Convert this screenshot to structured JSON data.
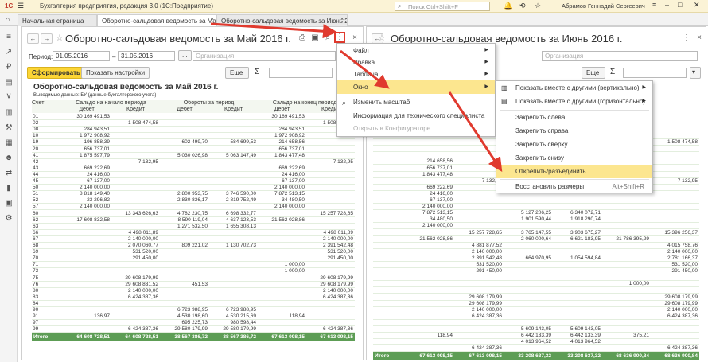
{
  "app": {
    "title": "Бухгалтерия предприятия, редакция 3.0  (1С:Предприятие)",
    "search_placeholder": "Поиск Ctrl+Shift+F",
    "user": "Абрамов Геннадий Сергеевич",
    "logo": "1С"
  },
  "tabs": [
    {
      "label": "Начальная страница"
    },
    {
      "label": "Оборотно-сальдовая ведомость за Май 2016 г."
    },
    {
      "label": "Оборотно-сальдовая ведомость за Июнь 2016 г."
    }
  ],
  "left_pane": {
    "title": "Оборотно-сальдовая ведомость за Май 2016 г.",
    "period_label": "Период:",
    "date_from": "01.05.2016",
    "date_to": "31.05.2016",
    "dots": "...",
    "org_placeholder": "Организация",
    "generate_button": "Сформировать",
    "settings_button": "Показать настройки",
    "more_button": "Еще",
    "sum_symbol": "Σ",
    "report_title": "Оборотно-сальдовая ведомость за Май 2016 г.",
    "report_subtitle": "Выводимые данные: БУ (данные бухгалтерского учета)",
    "h_account": "Счет",
    "h_start": "Сальдо на начало периода",
    "h_turn": "Обороты за период",
    "h_end": "Сальдо на конец периода",
    "h_debit": "Дебет",
    "h_credit": "Кредит",
    "rows": [
      [
        "01",
        "30 169 491,53",
        "",
        "",
        "",
        "30 169 491,53",
        ""
      ],
      [
        "02",
        "",
        "1 508 474,58",
        "",
        "",
        "",
        "1 508 474,58"
      ],
      [
        "08",
        "284 943,51",
        "",
        "",
        "",
        "284 943,51",
        ""
      ],
      [
        "10",
        "1 972 908,92",
        "",
        "",
        "",
        "1 972 908,92",
        ""
      ],
      [
        "19",
        "196 858,39",
        "",
        "602 499,70",
        "584 699,53",
        "214 658,56",
        ""
      ],
      [
        "20",
        "656 737,01",
        "",
        "",
        "",
        "656 737,01",
        ""
      ],
      [
        "41",
        "1 875 597,79",
        "",
        "5 030 026,98",
        "5 063 147,49",
        "1 843 477,48",
        ""
      ],
      [
        "42",
        "",
        "7 132,95",
        "",
        "",
        "",
        "7 132,95"
      ],
      [
        "43",
        "669 222,69",
        "",
        "",
        "",
        "669 222,69",
        ""
      ],
      [
        "44",
        "24 416,00",
        "",
        "",
        "",
        "24 416,00",
        ""
      ],
      [
        "45",
        "67 137,00",
        "",
        "",
        "",
        "67 137,00",
        ""
      ],
      [
        "50",
        "2 140 000,00",
        "",
        "",
        "",
        "2 140 000,00",
        ""
      ],
      [
        "51",
        "8 818 149,40",
        "",
        "2 800 953,75",
        "3 746 590,00",
        "7 872 513,15",
        ""
      ],
      [
        "52",
        "23 296,82",
        "",
        "2 830 836,17",
        "2 819 752,49",
        "34 480,50",
        ""
      ],
      [
        "57",
        "2 140 000,00",
        "",
        "",
        "",
        "2 140 000,00",
        ""
      ],
      [
        "60",
        "",
        "13 343 626,63",
        "4 782 230,75",
        "6 698 332,77",
        "",
        "15 257 728,65"
      ],
      [
        "62",
        "17 608 832,58",
        "",
        "8 590 119,04",
        "4 637 123,53",
        "21 562 028,86",
        ""
      ],
      [
        "63",
        "",
        "",
        "1 271 532,50",
        "1 655 308,13",
        "",
        ""
      ],
      [
        "66",
        "",
        "4 498 011,89",
        "",
        "",
        "",
        "4 498 011,89"
      ],
      [
        "67",
        "",
        "2 140 000,00",
        "",
        "",
        "",
        "2 140 000,00"
      ],
      [
        "68",
        "",
        "2 070 060,77",
        "809 221,02",
        "1 130 702,73",
        "",
        "2 391 542,48"
      ],
      [
        "69",
        "",
        "531 520,00",
        "",
        "",
        "",
        "531 520,00"
      ],
      [
        "70",
        "",
        "291 450,00",
        "",
        "",
        "",
        "291 450,00"
      ],
      [
        "71",
        "",
        "",
        "",
        "",
        "1 000,00",
        ""
      ],
      [
        "73",
        "",
        "",
        "",
        "",
        "1 000,00",
        ""
      ],
      [
        "75",
        "",
        "29 608 179,99",
        "",
        "",
        "",
        "29 608 179,99"
      ],
      [
        "76",
        "",
        "29 608 831,52",
        "451,53",
        "",
        "",
        "29 608 179,99"
      ],
      [
        "80",
        "",
        "2 140 000,00",
        "",
        "",
        "",
        "2 140 000,00"
      ],
      [
        "83",
        "",
        "6 424 387,36",
        "",
        "",
        "",
        "6 424 387,36"
      ],
      [
        "84",
        "",
        "",
        "",
        "",
        "",
        ""
      ],
      [
        "90",
        "",
        "",
        "6 723 988,95",
        "6 723 988,95",
        "",
        ""
      ],
      [
        "91",
        "136,97",
        "",
        "4 530 198,60",
        "4 530 215,69",
        "118,94",
        ""
      ],
      [
        "97",
        "",
        "",
        "695 225,73",
        "980 598,44",
        "",
        ""
      ],
      [
        "99",
        "",
        "6 424 387,36",
        "29 580 179,99",
        "29 580 179,99",
        "",
        "6 424 387,36"
      ]
    ],
    "total_label": "Итого",
    "total": [
      "64 608 728,51",
      "64 608 728,51",
      "38 567 386,72",
      "38 567 386,72",
      "67 613 098,15",
      "67 613 098,15"
    ]
  },
  "right_pane": {
    "title": "Оборотно-сальдовая ведомость за Июнь 2016 г.",
    "org_placeholder": "Организация",
    "more_button": "Еще",
    "total_label": "Итого",
    "rows": [
      [
        "",
        "",
        "",
        "",
        "30 169 491,53",
        ""
      ],
      [
        "",
        "",
        "",
        "",
        "",
        "1 508 474,58"
      ],
      [
        "",
        "",
        "",
        "",
        "284 943,51",
        ""
      ],
      [
        "",
        "",
        "",
        "",
        "1 972 908,92",
        ""
      ],
      [
        "214 658,56",
        "",
        "",
        "",
        "",
        ""
      ],
      [
        "656 737,01",
        "",
        "",
        "",
        "",
        ""
      ],
      [
        "1 843 477,48",
        "",
        "",
        "",
        "",
        ""
      ],
      [
        "",
        "7 132,95",
        "",
        "",
        "",
        "7 132,95"
      ],
      [
        "669 222,69",
        "",
        "",
        "",
        "",
        ""
      ],
      [
        "24 416,00",
        "",
        "",
        "",
        "",
        ""
      ],
      [
        "67 137,00",
        "",
        "",
        "",
        "",
        ""
      ],
      [
        "2 140 000,00",
        "",
        "",
        "",
        "",
        ""
      ],
      [
        "7 872 513,15",
        "",
        "5 127 206,25",
        "6 340 072,71",
        "",
        ""
      ],
      [
        "34 480,50",
        "",
        "1 901 590,44",
        "1 918 290,74",
        "",
        ""
      ],
      [
        "2 140 000,00",
        "",
        "",
        "",
        "",
        ""
      ],
      [
        "",
        "15 257 728,65",
        "3 765 147,55",
        "3 903 675,27",
        "",
        "15 396 256,37"
      ],
      [
        "21 562 028,86",
        "",
        "2 060 000,64",
        "6 621 183,95",
        "21 786 395,29",
        ""
      ],
      [
        "",
        "4 881 877,52",
        "",
        "",
        "",
        "4 015 758,76"
      ],
      [
        "",
        "2 140 000,00",
        "",
        "",
        "",
        "2 140 000,00"
      ],
      [
        "",
        "2 391 542,48",
        "664 970,95",
        "1 054 594,84",
        "",
        "2 781 166,37"
      ],
      [
        "",
        "531 520,00",
        "",
        "",
        "",
        "531 520,00"
      ],
      [
        "",
        "291 450,00",
        "",
        "",
        "",
        "291 450,00"
      ],
      [
        "",
        "",
        "",
        "",
        "",
        ""
      ],
      [
        "",
        "",
        "",
        "",
        "1 000,00",
        ""
      ],
      [
        "",
        "",
        "",
        "",
        "",
        ""
      ],
      [
        "",
        "29 608 179,99",
        "",
        "",
        "",
        "29 608 179,99"
      ],
      [
        "",
        "29 608 179,99",
        "",
        "",
        "",
        "29 608 179,99"
      ],
      [
        "",
        "2 140 000,00",
        "",
        "",
        "",
        "2 140 000,00"
      ],
      [
        "",
        "6 424 387,36",
        "",
        "",
        "",
        "6 424 387,36"
      ],
      [
        "",
        "",
        "",
        "",
        "",
        ""
      ],
      [
        "",
        "",
        "5 609 143,05",
        "5 609 143,05",
        "",
        ""
      ],
      [
        "118,94",
        "",
        "6 442 133,39",
        "6 442 133,39",
        "375,21",
        ""
      ],
      [
        "",
        "",
        "4 013 964,52",
        "4 013 964,52",
        "",
        ""
      ],
      [
        "",
        "6 424 387,36",
        "",
        "",
        "",
        "6 424 387,36"
      ]
    ],
    "total": [
      "67 613 098,15",
      "67 613 098,15",
      "33 208 637,32",
      "33 208 637,32",
      "68 636 900,84",
      "68 636 900,84"
    ]
  },
  "main_menu": {
    "items": [
      {
        "label": "Файл"
      },
      {
        "label": "Правка"
      },
      {
        "label": "Таблица"
      },
      {
        "label": "Окно"
      },
      {
        "label": "Изменить масштаб"
      },
      {
        "label": "Информация для технического специалиста"
      },
      {
        "label": "Открыть в Конфигураторе"
      }
    ]
  },
  "window_menu": {
    "items": [
      {
        "label": "Показать вместе с другими (вертикально)"
      },
      {
        "label": "Показать вместе с другими (горизонтально)"
      },
      {
        "label": "Закрепить слева"
      },
      {
        "label": "Закрепить справа"
      },
      {
        "label": "Закрепить сверху"
      },
      {
        "label": "Закрепить снизу"
      },
      {
        "label": "Открепить/разъединить"
      },
      {
        "label": "Восстановить размеры"
      }
    ],
    "shortcut": "Alt+Shift+R"
  },
  "colors": {
    "accent": "#fcd535",
    "highlight": "#fce68f",
    "total_row": "#5d9d55",
    "arrow": "#e03a2e"
  }
}
